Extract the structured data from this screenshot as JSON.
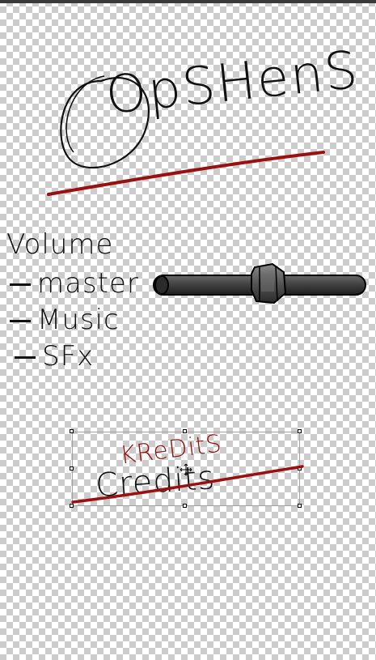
{
  "title": "OpSHenS",
  "volume": {
    "heading": "Volume",
    "items": [
      {
        "label": "master"
      },
      {
        "label": "Music"
      },
      {
        "label": "SFx"
      }
    ],
    "master_slider_level": 0.6
  },
  "credits": {
    "original": "Credits",
    "replacement": "KReDitS"
  },
  "colors": {
    "ink": "#111111",
    "accent_red": "#9a1010",
    "slider_dark": "#3a3a3a"
  }
}
